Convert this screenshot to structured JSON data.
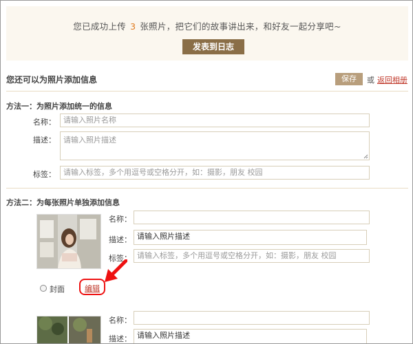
{
  "banner": {
    "text_before": "您已成功上传",
    "count": "3",
    "text_after": "张照片，把它们的故事讲出来，和好友一起分享吧~",
    "publish_button": "发表到日志"
  },
  "section": {
    "title": "您还可以为照片添加信息",
    "save_button": "保存",
    "or_text": "或",
    "return_link": "返回相册"
  },
  "method_one": {
    "title": "方法一：为照片添加统一的信息",
    "name_label": "名称：",
    "name_placeholder": "请输入照片名称",
    "desc_label": "描述：",
    "desc_placeholder": "请输入照片描述",
    "tags_label": "标签：",
    "tags_placeholder": "请输入标签，多个用逗号或空格分开，如：摄影，朋友 校园"
  },
  "method_two": {
    "title": "方法二：为每张照片单独添加信息",
    "photos": [
      {
        "name_label": "名称：",
        "name_value": "",
        "desc_label": "描述：",
        "desc_value": "请输入照片描述",
        "tags_label": "标签：",
        "tags_placeholder": "请输入标签，多个用逗号或空格分开，如：摄影，朋友 校园",
        "cover_label": "封面",
        "edit_link": "编辑"
      },
      {
        "name_label": "名称：",
        "name_value": "",
        "desc_label": "描述：",
        "desc_value": "请输入照片描述"
      }
    ]
  },
  "colors": {
    "accent_orange": "#e07b1f",
    "button_brown": "#8a6e47",
    "save_tan": "#b89e7c",
    "link_red": "#c0392b",
    "banner_bg": "#fbf7ef",
    "annotation_red": "#e11111"
  }
}
